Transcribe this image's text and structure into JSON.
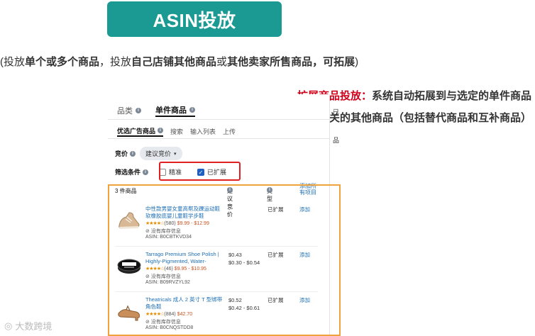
{
  "title": "ASIN投放",
  "subtitle": {
    "p1": "(投放",
    "b1": "单个或多个商品",
    "p2": "，投放",
    "b2": "自己店铺其他商品",
    "p3": "或",
    "b3": "其他卖家所售商品，可拓展",
    "p4": ")"
  },
  "annotation": {
    "label": "扩展商品投放：",
    "text": "系统自动拓展到与选定的单件商品密切相关的其他商品（包括替代商品和互补商品）"
  },
  "tabs": [
    {
      "label": "品类"
    },
    {
      "label": "单件商品"
    }
  ],
  "subtabs": [
    {
      "label": "优选广告商品"
    },
    {
      "label": "搜索"
    },
    {
      "label": "输入列表"
    },
    {
      "label": "上传"
    }
  ],
  "bid": {
    "label": "竞价",
    "dropdown": "建议竞价"
  },
  "filter": {
    "label": "筛选条件",
    "precise": "精准",
    "expanded": "已扩展"
  },
  "edge": {
    "t1": "已",
    "t2": "品"
  },
  "grid": {
    "count": "3 件商品",
    "col_bid": "建议竞价",
    "col_type": "类型",
    "add_all": "添加所有项目"
  },
  "products": [
    {
      "name": "中性款男婴女童高帮及踝运动鞋软橡胶底婴儿童鞋学步鞋",
      "rating": "★★★★☆",
      "reviews": "(580)",
      "price": "$9.99 - $12.99",
      "stock": "没有库存信息",
      "asin": "ASIN: B0CBTKVD34",
      "bid1": "-",
      "bid2": "",
      "type": "已扩展",
      "add": "添加"
    },
    {
      "name": "Tarrago Premium Shoe Polish | Highly-Pigmented, Water-",
      "rating": "★★★★☆",
      "reviews": "(46)",
      "price": "$9.95 - $10.95",
      "stock": "没有库存信息",
      "asin": "ASIN: B09RVZYL92",
      "bid1": "$0.43",
      "bid2": "$0.30 - $0.54",
      "type": "已扩展",
      "add": "添加"
    },
    {
      "name": "Theatricals 成人 2 英寸 T 型绑带角色鞋",
      "rating": "★★★★☆",
      "reviews": "(884)",
      "price": "$42.70",
      "stock": "没有库存信息",
      "asin": "ASIN: B0CNQSTDD8",
      "bid1": "$0.52",
      "bid2": "$0.42 - $0.61",
      "type": "已扩展",
      "add": "添加"
    }
  ],
  "watermark": "大数跨境",
  "colors": {
    "banner": "#1a9a93",
    "highlight_red": "#d0021b",
    "box_red": "#e02020",
    "box_orange": "#f0a33c",
    "link": "#1f6fb5"
  }
}
